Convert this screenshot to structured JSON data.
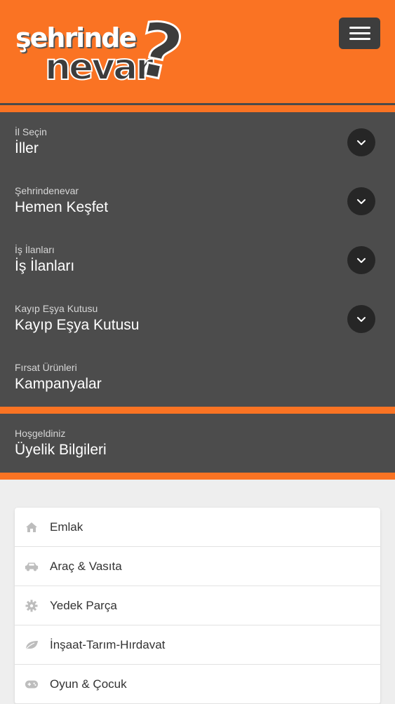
{
  "header": {
    "logo_line1": "şehrinde",
    "logo_line2": "nevar",
    "logo_mark": "?",
    "menu_icon": "hamburger-icon"
  },
  "nav": {
    "items": [
      {
        "sub": "İl Seçin",
        "label": "İller",
        "icon": "chevron-down-icon"
      },
      {
        "sub": "Şehrindenevar",
        "label": "Hemen Keşfet",
        "icon": "chevron-down-icon"
      },
      {
        "sub": "İş İlanları",
        "label": "İş İlanları",
        "icon": "chevron-down-icon"
      },
      {
        "sub": "Kayıp Eşya Kutusu",
        "label": "Kayıp Eşya Kutusu",
        "icon": "chevron-down-icon"
      },
      {
        "sub": "Fırsat Ürünleri",
        "label": "Kampanyalar"
      }
    ]
  },
  "welcome": {
    "sub": "Hoşgeldiniz",
    "label": "Üyelik Bilgileri"
  },
  "categories": [
    {
      "label": "Emlak",
      "icon": "home-icon"
    },
    {
      "label": "Araç & Vasıta",
      "icon": "car-icon"
    },
    {
      "label": "Yedek Parça",
      "icon": "gear-icon"
    },
    {
      "label": "İnşaat-Tarım-Hırdavat",
      "icon": "leaf-icon"
    },
    {
      "label": "Oyun & Çocuk",
      "icon": "gamepad-icon"
    }
  ],
  "colors": {
    "brand": "#fa7323",
    "panel": "#4c4c4c",
    "button": "#3d3d3d"
  }
}
